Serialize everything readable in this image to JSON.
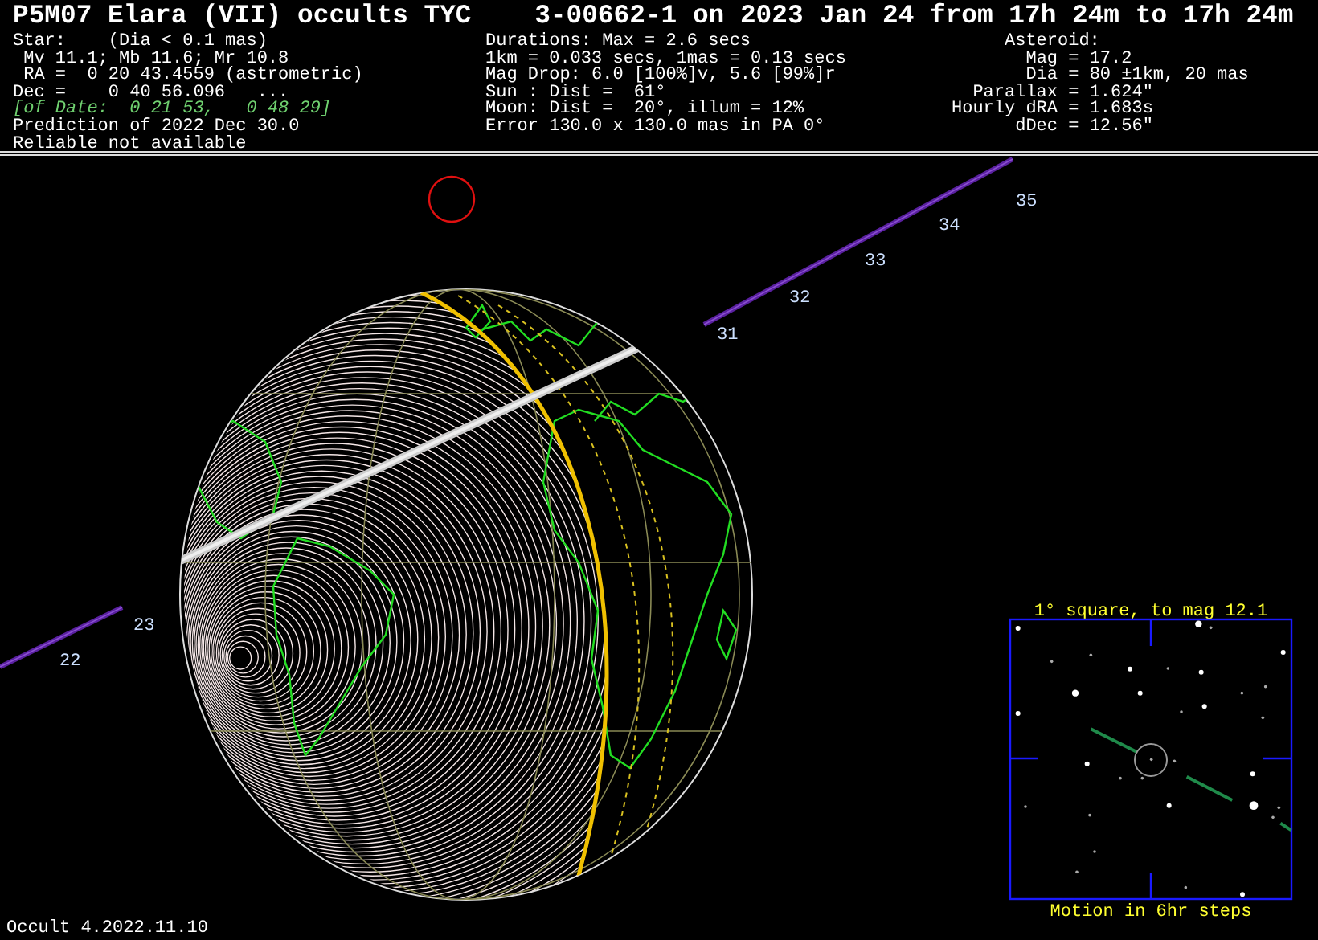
{
  "title": "P5M07 Elara (VII) occults TYC    3-00662-1 on 2023 Jan 24 from 17h 24m to 17h 24m",
  "star_info": [
    {
      "kind": "plain",
      "text": "Star:    (Dia < 0.1 mas)"
    },
    {
      "kind": "plain",
      "text": " Mv 11.1; Mb 11.6; Mr 10.8"
    },
    {
      "kind": "plain",
      "text": " RA =  0 20 43.4559 (astrometric)"
    },
    {
      "kind": "plain",
      "text": "Dec =    0 40 56.096   ..."
    },
    {
      "kind": "of_date",
      "text": "[of Date:  0 21 53,   0 48 29]"
    },
    {
      "kind": "plain",
      "text": "Prediction of 2022 Dec 30.0"
    },
    {
      "kind": "plain",
      "text": "Reliable not available"
    }
  ],
  "event_info": [
    "Durations: Max = 2.6 secs",
    "1km = 0.033 secs, 1mas = 0.13 secs",
    "Mag Drop: 6.0 [100%]v, 5.6 [99%]r",
    "Sun : Dist =  61°",
    "Moon: Dist =  20°, illum = 12%",
    "Error 130.0 x 130.0 mas in PA 0°"
  ],
  "asteroid": {
    "heading": "Asteroid:",
    "rows": [
      {
        "label": "Mag =",
        "value": "17.2"
      },
      {
        "label": "Dia =",
        "value": "80 ±1km, 20 mas"
      },
      {
        "label": "Parallax =",
        "value": "1.624\""
      },
      {
        "label": "Hourly dRA =",
        "value": "1.683s"
      },
      {
        "label": "dDec =",
        "value": "12.56\""
      }
    ]
  },
  "map": {
    "track_segments": [
      {
        "ticks": [
          "22",
          "23"
        ]
      },
      {
        "ticks": [
          "31",
          "32",
          "33",
          "34",
          "35"
        ]
      }
    ]
  },
  "finder_chart": {
    "title": "1° square, to mag 12.1",
    "caption": "Motion in 6hr steps"
  },
  "version": "Occult 4.2022.11.10"
}
